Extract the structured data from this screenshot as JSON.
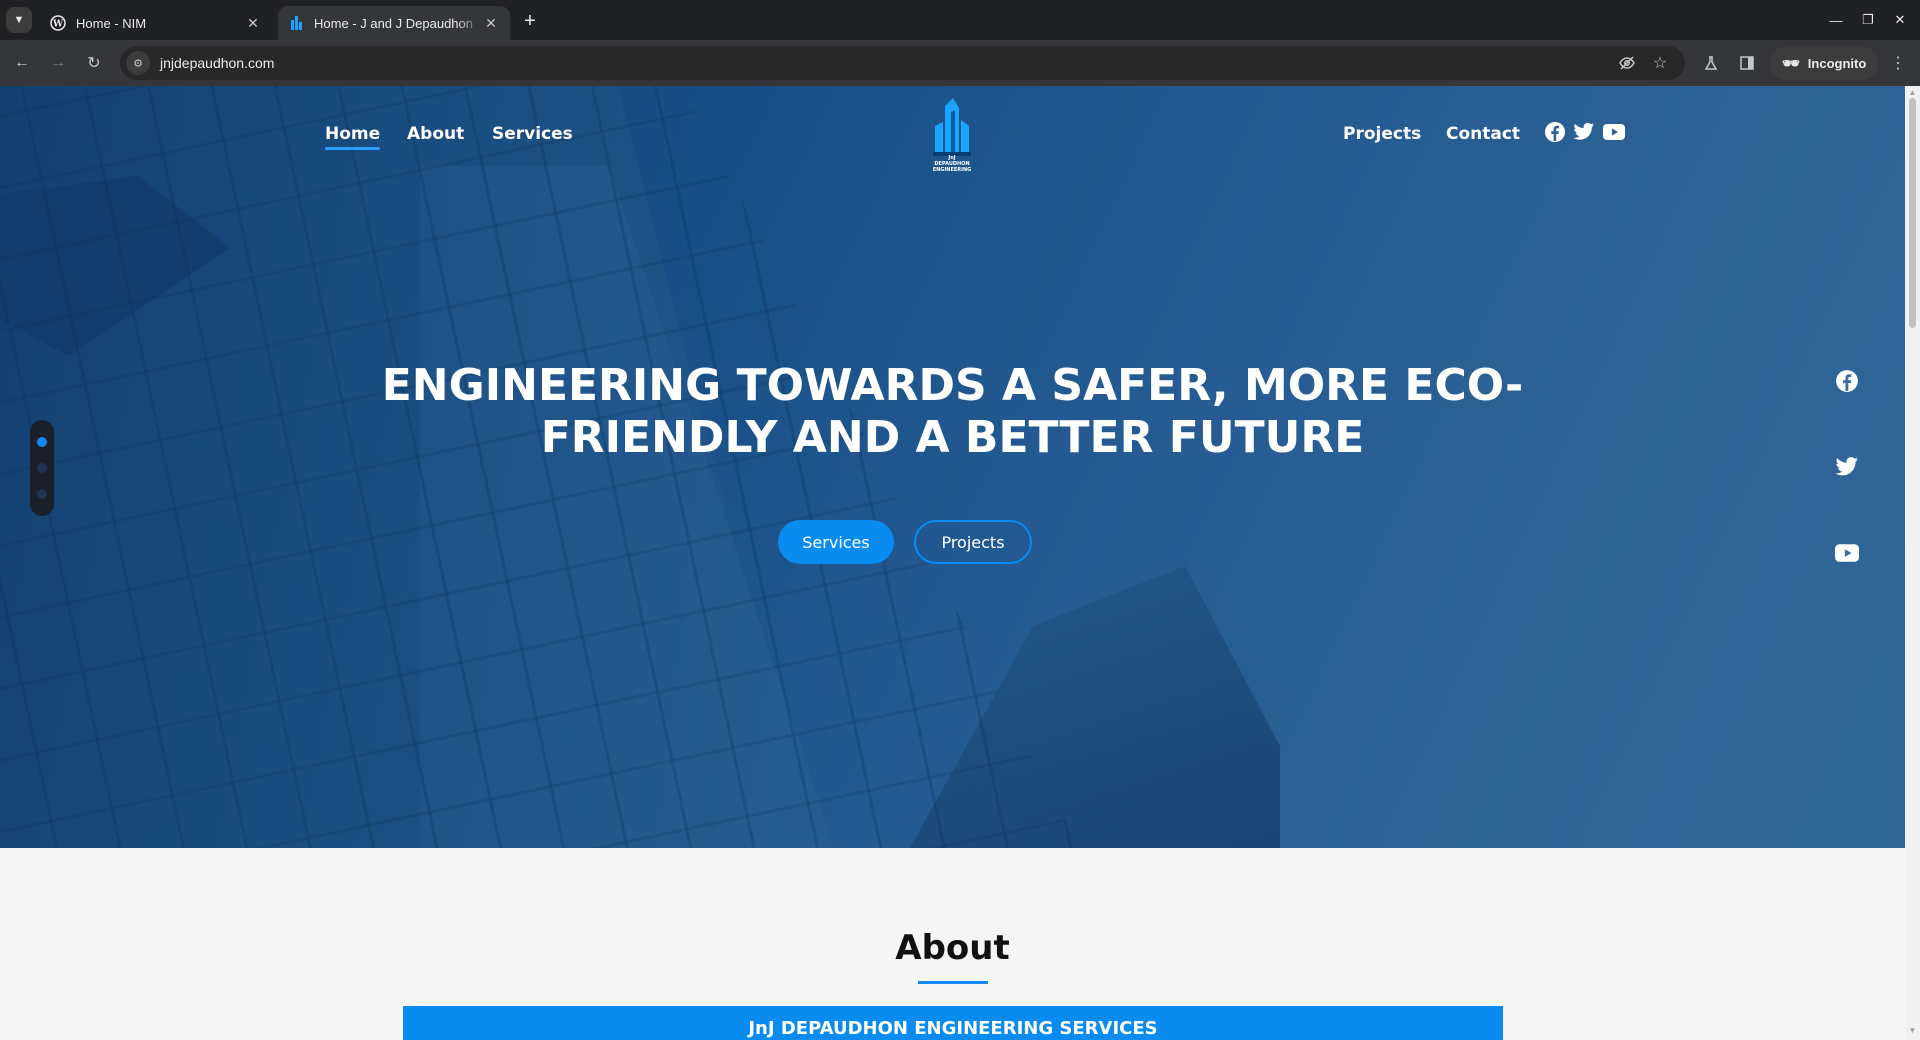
{
  "browser": {
    "tabs": [
      {
        "title": "Home - NIM",
        "favicon": "wordpress-icon"
      },
      {
        "title": "Home - J and J Depaudhon",
        "favicon": "jnj-logo-icon",
        "active": true
      }
    ],
    "new_tab": "+",
    "url": "jnjdepaudhon.com",
    "incognito_label": "Incognito"
  },
  "site": {
    "nav_left": [
      "Home",
      "About",
      "Services"
    ],
    "nav_right": [
      "Projects",
      "Contact"
    ],
    "active_nav": "Home",
    "logo_text": "JnJ\nDEPAUDHON\nENGINEERING",
    "social_icons": [
      "facebook-icon",
      "twitter-icon",
      "youtube-icon"
    ]
  },
  "hero": {
    "title": "ENGINEERING TOWARDS A SAFER, MORE ECO-FRIENDLY AND A BETTER FUTURE",
    "primary_button": "Services",
    "secondary_button": "Projects",
    "slides_total": 3,
    "active_slide": 1
  },
  "about": {
    "heading": "About",
    "banner": "JnJ DEPAUDHON ENGINEERING SERVICES"
  },
  "colors": {
    "accent": "#0a8bf0",
    "hero_tint": "#1a5288",
    "chrome_bg": "#202124"
  }
}
